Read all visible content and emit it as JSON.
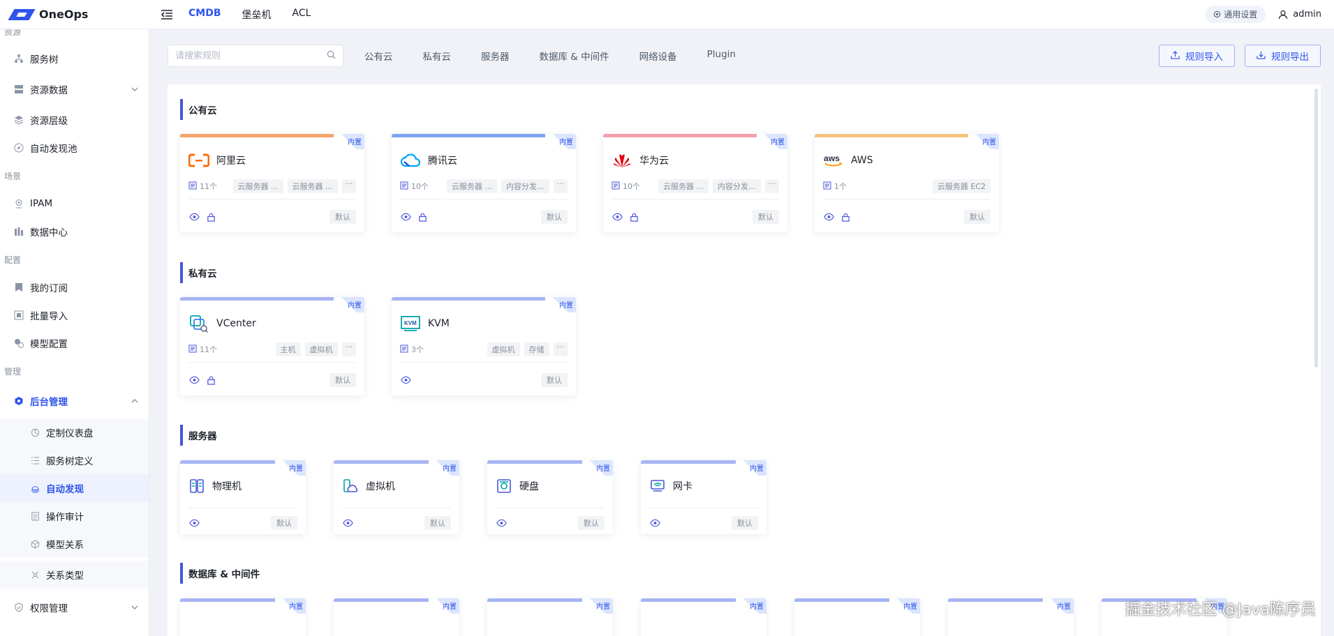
{
  "app": {
    "name": "OneOps"
  },
  "topnav": [
    "CMDB",
    "堡垒机",
    "ACL"
  ],
  "top_right": {
    "settings_label": "通用设置",
    "user": "admin"
  },
  "sidebar": {
    "groups": [
      "资源",
      "场景",
      "配置",
      "管理"
    ],
    "items": [
      {
        "label": "服务树",
        "icon": "tree-icon"
      },
      {
        "label": "资源数据",
        "icon": "database-icon"
      },
      {
        "label": "资源层级",
        "icon": "layers-icon"
      },
      {
        "label": "自动发现池",
        "icon": "compass-icon"
      },
      {
        "label": "IPAM",
        "icon": "location-icon"
      },
      {
        "label": "数据中心",
        "icon": "building-icon"
      },
      {
        "label": "我的订阅",
        "icon": "bookmark-icon"
      },
      {
        "label": "批量导入",
        "icon": "import-icon"
      },
      {
        "label": "模型配置",
        "icon": "model-icon"
      },
      {
        "label": "后台管理",
        "icon": "admin-icon"
      },
      {
        "label": "权限管理",
        "icon": "shield-icon"
      }
    ],
    "subitems": [
      {
        "label": "定制仪表盘",
        "icon": "dashboard-icon"
      },
      {
        "label": "服务树定义",
        "icon": "list-icon"
      },
      {
        "label": "自动发现",
        "icon": "discover-icon"
      },
      {
        "label": "操作审计",
        "icon": "audit-icon"
      },
      {
        "label": "模型关系",
        "icon": "cube-icon"
      },
      {
        "label": "关系类型",
        "icon": "relation-icon"
      }
    ]
  },
  "toolbar": {
    "search_placeholder": "请搜索规则",
    "filters": [
      "公有云",
      "私有云",
      "服务器",
      "数据库 & 中间件",
      "网络设备",
      "Plugin"
    ],
    "import_label": "规则导入",
    "export_label": "规则导出"
  },
  "builtin_tag": "内置",
  "default_badge": "默认",
  "sections": [
    {
      "title": "公有云",
      "cards": [
        {
          "name": "阿里云",
          "count": "11个",
          "chips": [
            "云服务器 ...",
            "云服务器 ..."
          ],
          "more": true,
          "color": "#f5a26b"
        },
        {
          "name": "腾讯云",
          "count": "10个",
          "chips": [
            "云服务器 ...",
            "内容分发..."
          ],
          "more": true,
          "color": "#7ea3f0"
        },
        {
          "name": "华为云",
          "count": "10个",
          "chips": [
            "云服务器 ...",
            "内容分发..."
          ],
          "more": true,
          "color": "#f3a0ad"
        },
        {
          "name": "AWS",
          "count": "1个",
          "chips": [
            "云服务器 EC2"
          ],
          "more": false,
          "color": "#f7c27a"
        }
      ]
    },
    {
      "title": "私有云",
      "cards": [
        {
          "name": "VCenter",
          "count": "11个",
          "chips": [
            "主机",
            "虚拟机"
          ],
          "more": true,
          "color": "#a7b5f3"
        },
        {
          "name": "KVM",
          "count": "3个",
          "chips": [
            "虚拟机",
            "存储"
          ],
          "more": true,
          "color": "#a7b5f3"
        }
      ]
    },
    {
      "title": "服务器",
      "cards": [
        {
          "name": "物理机"
        },
        {
          "name": "虚拟机"
        },
        {
          "name": "硬盘"
        },
        {
          "name": "网卡"
        }
      ]
    },
    {
      "title": "数据库 & 中间件",
      "cards_count": 7
    }
  ],
  "watermark": "掘金技术社区 @Java陈序员"
}
